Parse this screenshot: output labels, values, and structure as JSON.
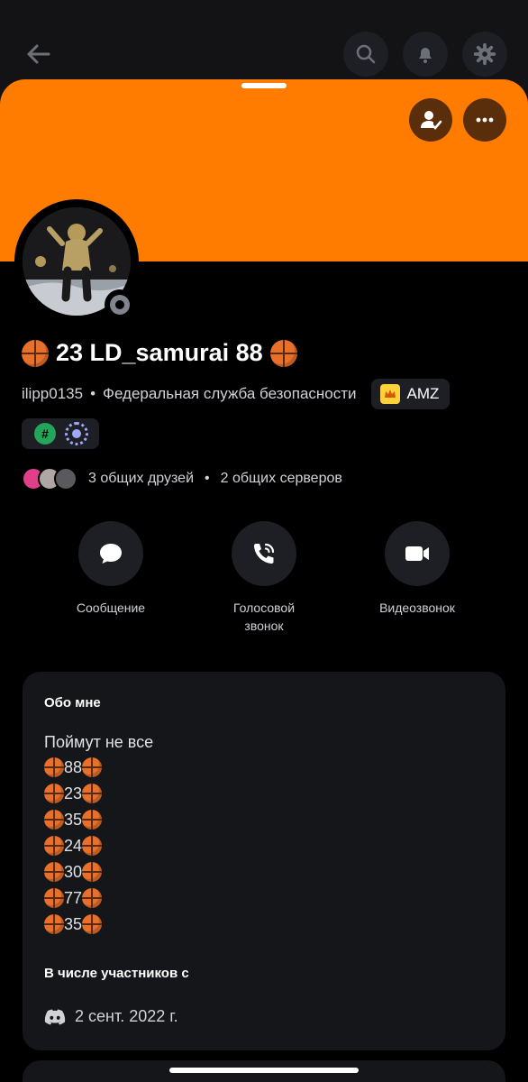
{
  "header": {
    "back_icon": "arrow-left-icon",
    "search_icon": "search-icon",
    "bell_icon": "bell-icon",
    "gear_icon": "gear-icon"
  },
  "banner": {
    "color": "#ff7c00",
    "friend_icon": "user-check-icon",
    "more_icon": "more-horizontal-icon"
  },
  "profile": {
    "display_name": "23 LD_samurai 88",
    "username": "ilipp0135",
    "separator": "•",
    "pronouns_note": "Федеральная служба безопасности",
    "clan_tag": "AMZ",
    "status": "offline"
  },
  "mutual": {
    "friends": "3 общих друзей",
    "dot": "•",
    "servers": "2 общих серверов"
  },
  "actions": {
    "message": "Сообщение",
    "voice_call": "Голосовой звонок",
    "video_call": "Видеозвонок"
  },
  "about": {
    "title": "Обо мне",
    "intro": "Поймут не все",
    "numbers": [
      "88",
      "23",
      "35",
      "24",
      "30",
      "77",
      "35"
    ],
    "member_since_title": "В числе участников с",
    "member_since_date": "2 сент. 2022 г."
  }
}
